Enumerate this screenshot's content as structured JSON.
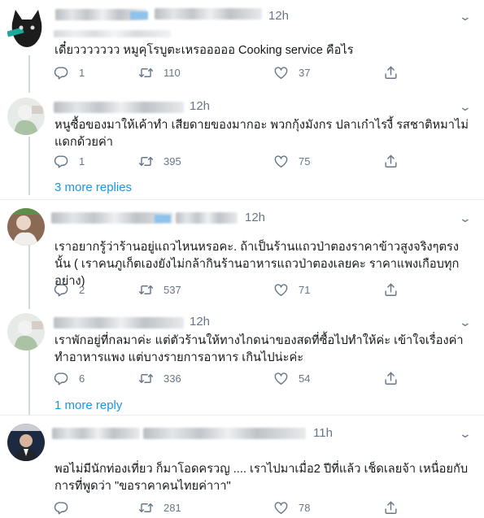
{
  "tweets": [
    {
      "time": "12h",
      "text": "เดี๋ยววววววว หมูคุโรบูตะเหรอออออ Cooking service คือไร",
      "reply_count": "1",
      "retweet_count": "110",
      "like_count": "37"
    },
    {
      "time": "12h",
      "text": "หนูซื้อของมาให้เค้าทำ เสียดายของมากอะ พวกกุ้งมังกร ปลาเก๋าไรงี้ รสชาติหมาไม่แดกด้วยค่า",
      "reply_count": "1",
      "retweet_count": "395",
      "like_count": "75",
      "more_replies": "3 more replies"
    },
    {
      "time": "12h",
      "text": "เราอยากรู้ว่าร้านอยู่แถวไหนหรอคะ. ถ้าเป็นร้านแถวป่าตองราคาข้าวสูงจริงๆตรงนั้น ( เราคนภูเก็ตเองยังไม่กล้ากินร้านอาหารแถวป่าตองเลยคะ ราคาแพงเกือบทุกอย่าง)",
      "reply_count": "2",
      "retweet_count": "537",
      "like_count": "71"
    },
    {
      "time": "12h",
      "text": "เราพักอยู่ที่กลมาค่ะ แต่ตัวร้านให้ทางไกดน่าของสดที่ซื้อไปทำให้ค่ะ เข้าใจเรื่องค่าทำอาหารแพง แต่บางรายการอาหาร เกินไปน่ะค่ะ",
      "reply_count": "6",
      "retweet_count": "336",
      "like_count": "54",
      "more_replies": "1 more reply"
    },
    {
      "time": "11h",
      "text": "พอไม่มีนักท่องเที่ยว ก็มาโอดครวญ .... เราไปมาเมื่อ2 ปีที่แล้ว เช็ดเลยจ้า เหนื่อยกับการที่พูดว่า \"ขอราคาคนไทยค่าาา\"",
      "reply_count": "",
      "retweet_count": "281",
      "like_count": "78"
    }
  ],
  "colors": {
    "text": "#14171a",
    "muted": "#657786",
    "link": "#1b95e0",
    "divider": "#e6ecf0"
  },
  "icons": [
    "reply-icon",
    "retweet-icon",
    "like-icon",
    "share-icon",
    "chevron-down-icon"
  ]
}
